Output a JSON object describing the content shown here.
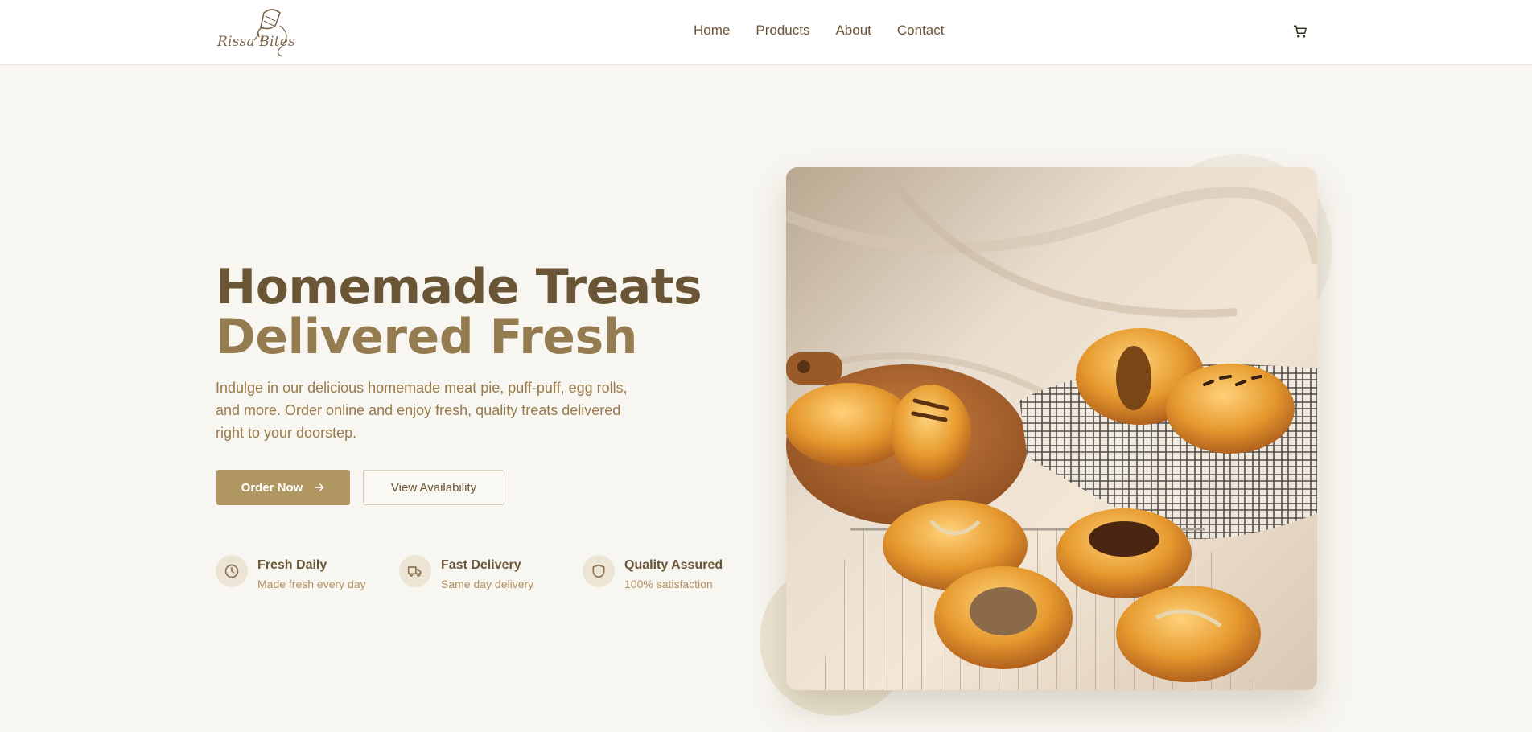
{
  "header": {
    "logo_text": "Rissa Bites",
    "nav": [
      "Home",
      "Products",
      "About",
      "Contact"
    ],
    "cart_icon": "cart-icon"
  },
  "hero": {
    "title_line1": "Homemade Treats",
    "title_line2": "Delivered Fresh",
    "description": "Indulge in our delicious homemade meat pie, puff-puff, egg rolls, and more. Order online and enjoy fresh, quality treats delivered right to your doorstep.",
    "primary_button": "Order Now",
    "secondary_button": "View Availability",
    "image_icon": "pastries-photo"
  },
  "features": [
    {
      "icon": "clock-icon",
      "title": "Fresh Daily",
      "subtitle": "Made fresh every day"
    },
    {
      "icon": "truck-icon",
      "title": "Fast Delivery",
      "subtitle": "Same day delivery"
    },
    {
      "icon": "shield-icon",
      "title": "Quality Assured",
      "subtitle": "100% satisfaction"
    }
  ],
  "colors": {
    "background": "#f8f6f1",
    "title_dark": "#6a5537",
    "title_accent": "#957b50",
    "button_primary": "#b09661",
    "text_muted": "#9a7b4c"
  }
}
